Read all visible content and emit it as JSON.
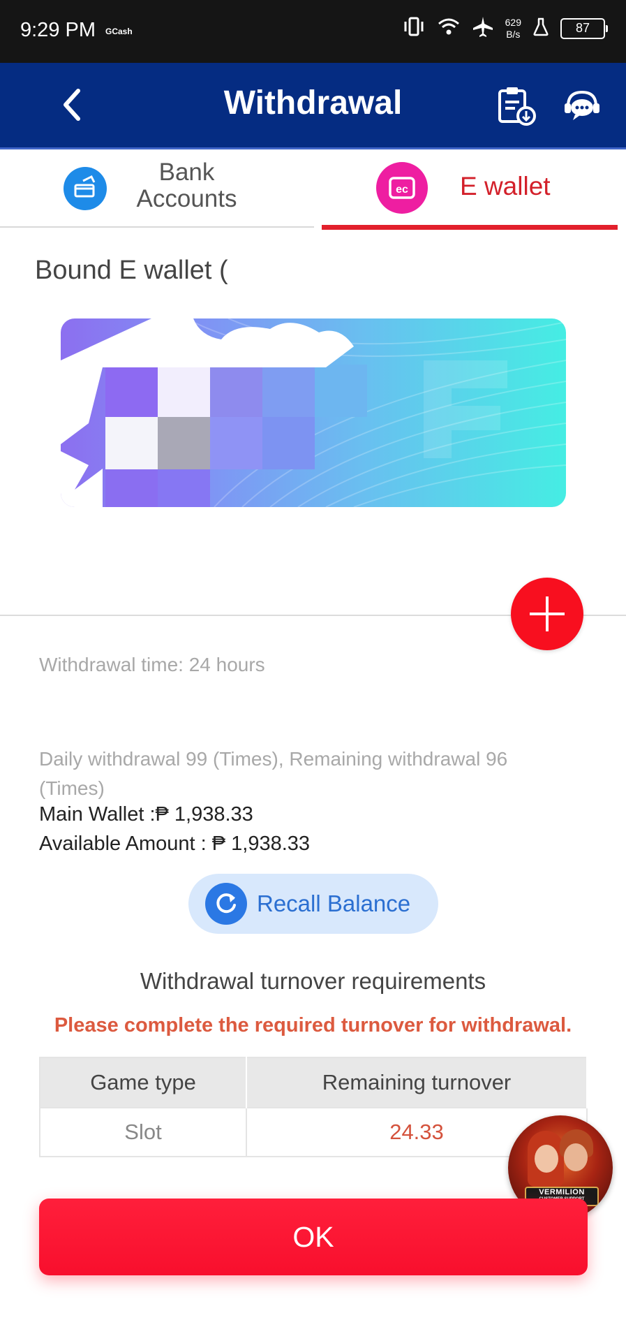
{
  "status_bar": {
    "time": "9:29 PM",
    "app": "GCash",
    "speed_value": "629",
    "speed_unit": "B/s",
    "battery": "87"
  },
  "header": {
    "title": "Withdrawal"
  },
  "tabs": [
    {
      "label": "Bank Accounts",
      "active": false
    },
    {
      "label": "E wallet",
      "active": true
    }
  ],
  "bound_section": {
    "title": "Bound E wallet (",
    "redacted": true
  },
  "info": {
    "withdrawal_time": "Withdrawal time:  24 hours",
    "daily_limit": "Daily withdrawal 99 (Times), Remaining withdrawal 96 (Times)",
    "main_wallet": "Main Wallet :₱ 1,938.33",
    "available_amount": "Available Amount : ₱ 1,938.33"
  },
  "recall_button": {
    "label": "Recall Balance"
  },
  "turnover": {
    "title": "Withdrawal turnover requirements",
    "warning": "Please complete the required turnover for withdrawal.",
    "columns": [
      "Game type",
      "Remaining turnover"
    ],
    "rows": [
      {
        "game_type": "Slot",
        "remaining": "24.33"
      }
    ]
  },
  "support_badge": {
    "line1": "VERMILION",
    "line2": "CUSTOMER SUPPORT"
  },
  "ok_button": {
    "label": "OK"
  },
  "colors": {
    "header_bg": "#052c82",
    "accent_red": "#e2202c",
    "ok_button": "#ff1f3b",
    "recall_bg": "#d8e8fc",
    "recall_text": "#2b6fd1",
    "warning_text": "#dc5a3f"
  },
  "icons": {
    "back": "chevron-left-icon",
    "records": "clipboard-download-icon",
    "support": "chat-support-icon",
    "bank": "bank-card-icon",
    "ewallet": "ewallet-icon",
    "add": "plus-icon",
    "recall": "refresh-icon"
  }
}
